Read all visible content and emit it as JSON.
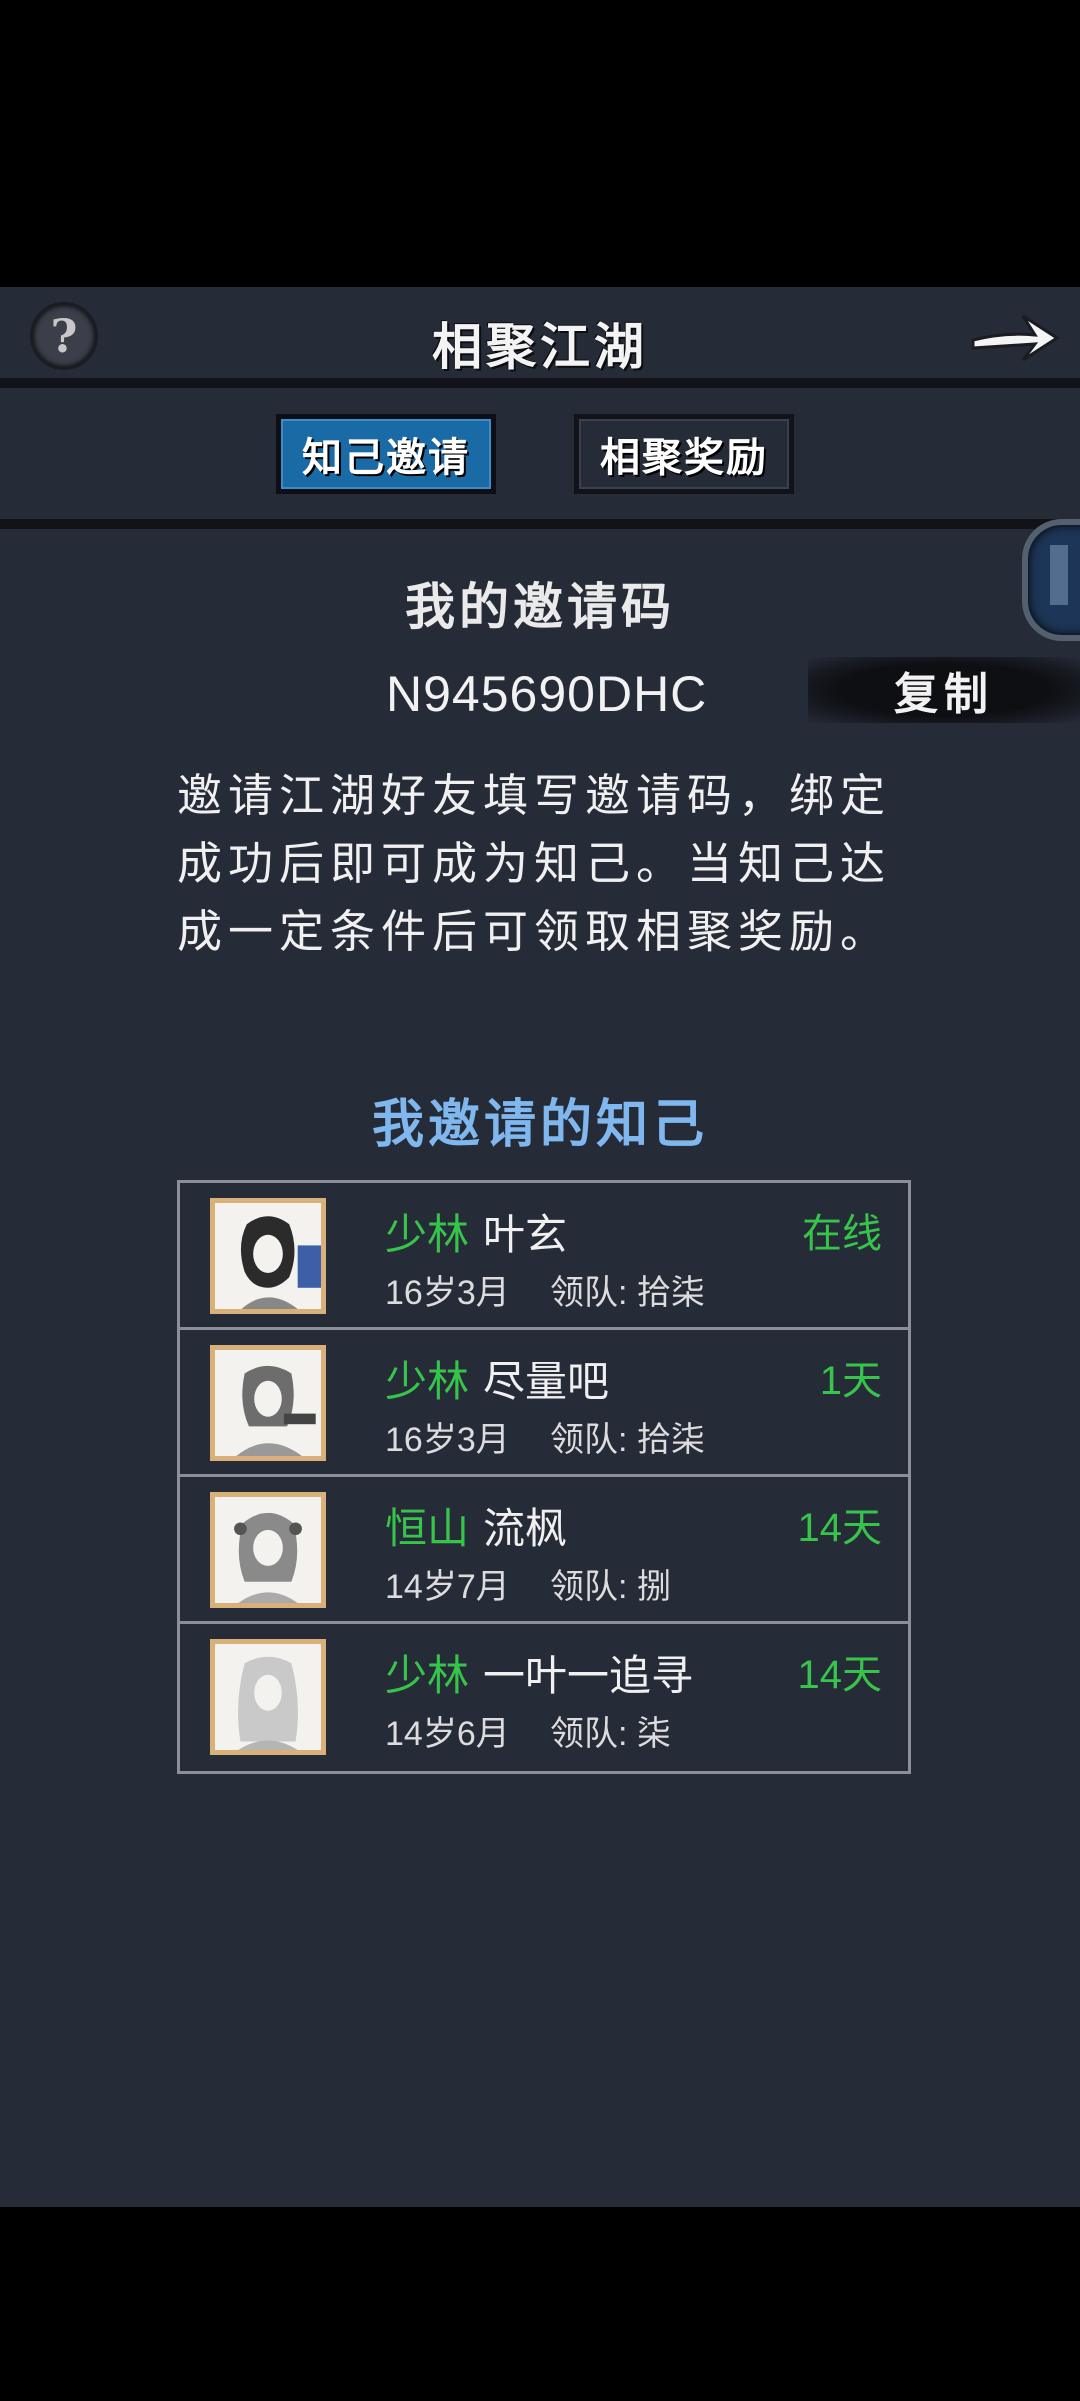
{
  "header": {
    "title": "相聚江湖",
    "help_icon": "?"
  },
  "tabs": [
    {
      "label": "知己邀请",
      "active": true
    },
    {
      "label": "相聚奖励",
      "active": false
    }
  ],
  "invite": {
    "heading": "我的邀请码",
    "code": "N945690DHC",
    "copy_label": "复制",
    "description": "邀请江湖好友填写邀请码，绑定成功后即可成为知己。当知己达成一定条件后可领取相聚奖励。"
  },
  "friends": {
    "heading": "我邀请的知己",
    "items": [
      {
        "sect": "少林",
        "name": "叶玄",
        "status": "在线",
        "age": "16岁3月",
        "leader_label": "领队:",
        "leader": "拾柒"
      },
      {
        "sect": "少林",
        "name": "尽量吧",
        "status": "1天",
        "age": "16岁3月",
        "leader_label": "领队:",
        "leader": "拾柒"
      },
      {
        "sect": "恒山",
        "name": "流枫",
        "status": "14天",
        "age": "14岁7月",
        "leader_label": "领队:",
        "leader": "捌"
      },
      {
        "sect": "少林",
        "name": "一叶一追寻",
        "status": "14天",
        "age": "14岁6月",
        "leader_label": "领队:",
        "leader": "柒"
      }
    ]
  },
  "colors": {
    "background": "#262b38",
    "accent_blue": "#1a6aa6",
    "online_green": "#37c44a",
    "heading_blue": "#7fb7ee"
  }
}
